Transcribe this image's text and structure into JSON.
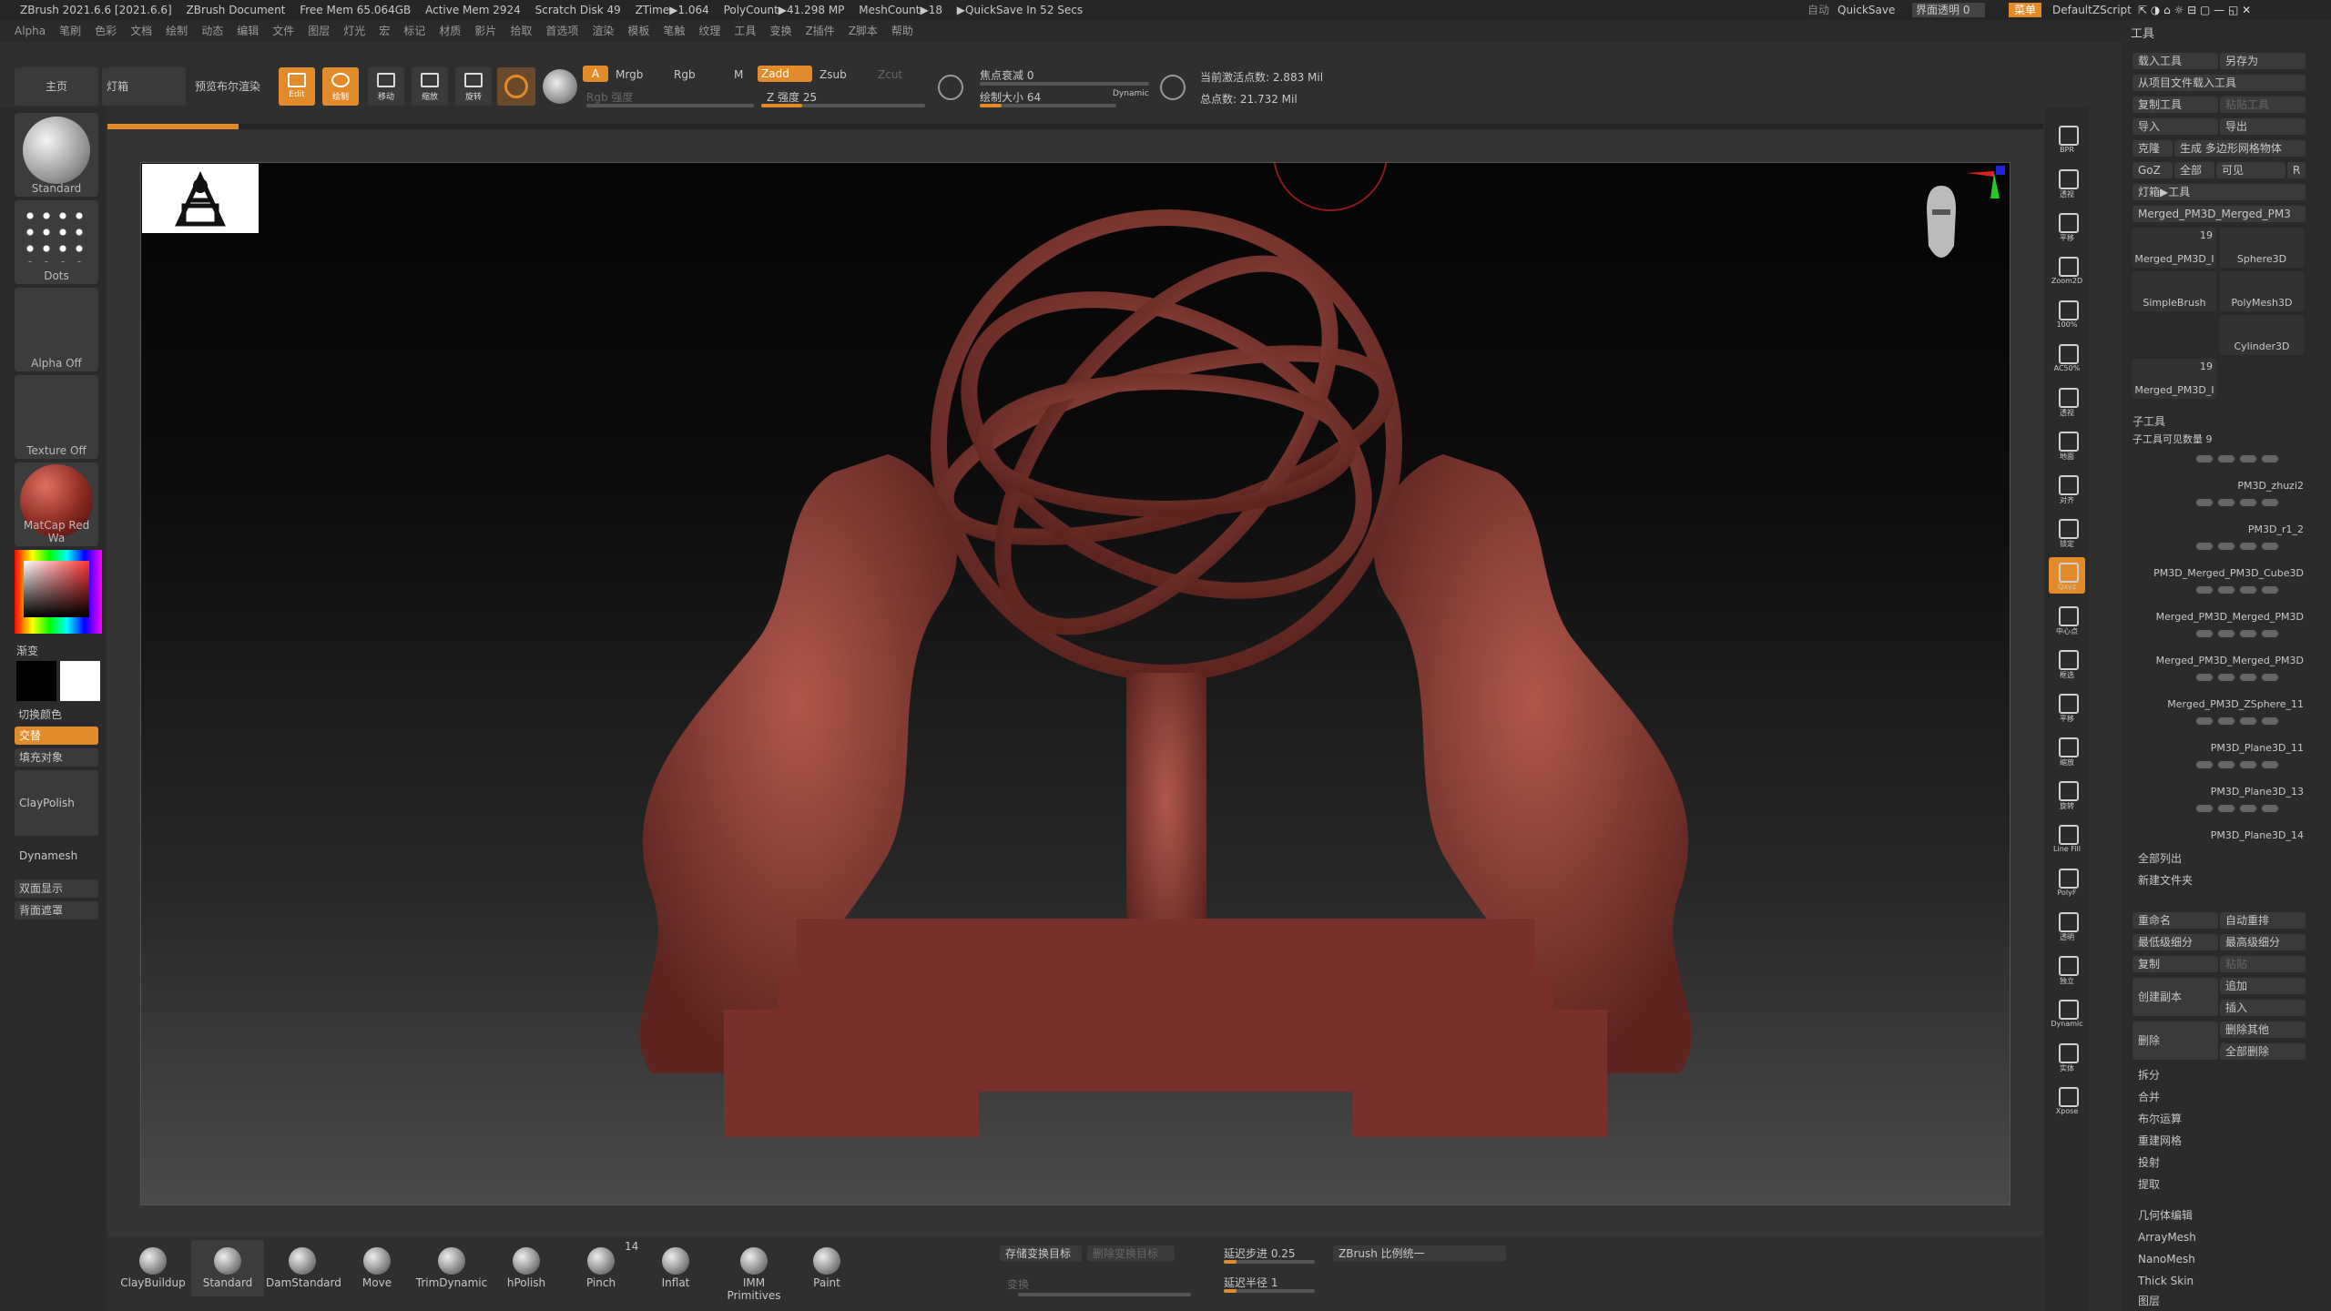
{
  "titlebar": {
    "app": "ZBrush 2021.6.6 [2021.6.6]",
    "doc": "ZBrush Document",
    "free_mem": "Free Mem 65.064GB",
    "active_mem": "Active Mem 2924",
    "scratch": "Scratch Disk 49",
    "ztime": "ZTime▶1.064",
    "polycount": "PolyCount▶41.298 MP",
    "meshcount": "MeshCount▶18",
    "quicksave_info": "▶QuickSave In 52 Secs",
    "auto": "自动",
    "quicksave": "QuickSave",
    "interface_transp": "界面透明 0",
    "menu": "菜单",
    "script": "DefaultZScript"
  },
  "menubar": [
    "Alpha",
    "笔刷",
    "色彩",
    "文档",
    "绘制",
    "动态",
    "编辑",
    "文件",
    "图层",
    "灯光",
    "宏",
    "标记",
    "材质",
    "影片",
    "拾取",
    "首选项",
    "渲染",
    "模板",
    "笔触",
    "纹理",
    "工具",
    "变换",
    "Z插件",
    "Z脚本",
    "帮助"
  ],
  "topshelf": {
    "home": "主页",
    "lightbox": "灯箱",
    "bpr": "预览布尔渲染",
    "edit": "Edit",
    "draw": "绘制",
    "move": "移动",
    "scale": "缩放",
    "rotate": "旋转",
    "a": "A",
    "mrgb": "Mrgb",
    "rgb": "Rgb",
    "m": "M",
    "zadd": "Zadd",
    "zsub": "Zsub",
    "zcut": "Zcut",
    "rgb_intensity": "Rgb 强度",
    "z_intensity": "Z 强度 25",
    "z_intensity_val": 25,
    "focal_shift": "焦点衰减 0",
    "draw_size": "绘制大小 64",
    "draw_size_val": 64,
    "dynamic": "Dynamic",
    "active_points": "当前激活点数: 2.883 Mil",
    "total_points": "总点数: 21.732 Mil"
  },
  "leftshelf": {
    "brush": "Standard",
    "stroke": "Dots",
    "alpha": "Alpha Off",
    "texture": "Texture Off",
    "material": "MatCap Red Wa",
    "gradient": "渐变",
    "switch_color": "切换颜色",
    "alternate": "交替",
    "fill": "填充对象",
    "claypolish": "ClayPolish",
    "dynamesh": "Dynamesh",
    "double": "双面显示",
    "backface": "背面遮罩"
  },
  "bottomshelf": {
    "brushes": [
      "ClayBuildup",
      "Standard",
      "DamStandard",
      "Move",
      "TrimDynamic",
      "hPolish",
      "Pinch",
      "Inflat",
      "IMM Primitives",
      "Paint"
    ],
    "imm_count": "14",
    "store_morph": "存储变换目标",
    "delete_morph": "删除变换目标",
    "morph": "变换",
    "lazy_step": "延迟步进 0.25",
    "lazy_radius": "延迟半径 1",
    "zbrush_scale": "ZBrush 比例统一"
  },
  "rightshelf": [
    "BPR",
    "透视",
    "平移",
    "Zoom2D",
    "100%",
    "AC50%",
    "透视",
    "地面",
    "对齐",
    "锁定",
    "Qxyz",
    "中心点",
    "框选",
    "平移",
    "缩放",
    "旋转",
    "Line Fill",
    "PolyF",
    "透明",
    "独立",
    "Dynamic",
    "实体",
    "Xpose"
  ],
  "tool_panel": {
    "title": "工具",
    "load": "载入工具",
    "saveas": "另存为",
    "load_from_project": "从项目文件载入工具",
    "copy": "复制工具",
    "paste": "粘贴工具",
    "import": "导入",
    "export": "导出",
    "clone": "克隆",
    "make_polymesh": "生成 多边形网格物体",
    "goz": "GoZ",
    "all": "全部",
    "visible": "可见",
    "r": "R",
    "lightbox_tools": "灯箱▶工具",
    "current": "Merged_PM3D_Merged_PM3",
    "tools": [
      {
        "name": "Merged_PM3D_I",
        "count": "19"
      },
      {
        "name": "Sphere3D"
      },
      {
        "name": "SimpleBrush"
      },
      {
        "name": "PolyMesh3D"
      },
      {
        "name": "Cylinder3D"
      },
      {
        "name": "Merged_PM3D_I",
        "count": "19"
      }
    ],
    "subtool_header": "子工具",
    "visible_count": "子工具可见数量 9",
    "subtools": [
      "PM3D_zhuzi2",
      "PM3D_r1_2",
      "PM3D_Merged_PM3D_Cube3D",
      "Merged_PM3D_Merged_PM3D",
      "Merged_PM3D_Merged_PM3D",
      "Merged_PM3D_ZSphere_11",
      "PM3D_Plane3D_11",
      "PM3D_Plane3D_13",
      "PM3D_Plane3D_14"
    ],
    "list_all": "全部列出",
    "new_folder": "新建文件夹",
    "rename": "重命名",
    "autoreorder": "自动重排",
    "lowest": "最低级细分",
    "highest": "最高级细分",
    "duplicate": "复制",
    "paste2": "粘贴",
    "copy2": "创建副本",
    "append": "追加",
    "insert": "插入",
    "delete": "删除",
    "del_other": "删除其他",
    "del_all": "全部删除",
    "split": "拆分",
    "merge": "合并",
    "boolean": "布尔运算",
    "remesh": "重建网格",
    "project": "投射",
    "extract": "提取",
    "geometry": "几何体编辑",
    "arraymesh": "ArrayMesh",
    "nanomesh": "NanoMesh",
    "thickskin": "Thick Skin",
    "layers": "图层"
  },
  "colors": {
    "accent": "#e38a2b",
    "sculpt": "#8a3a33"
  }
}
